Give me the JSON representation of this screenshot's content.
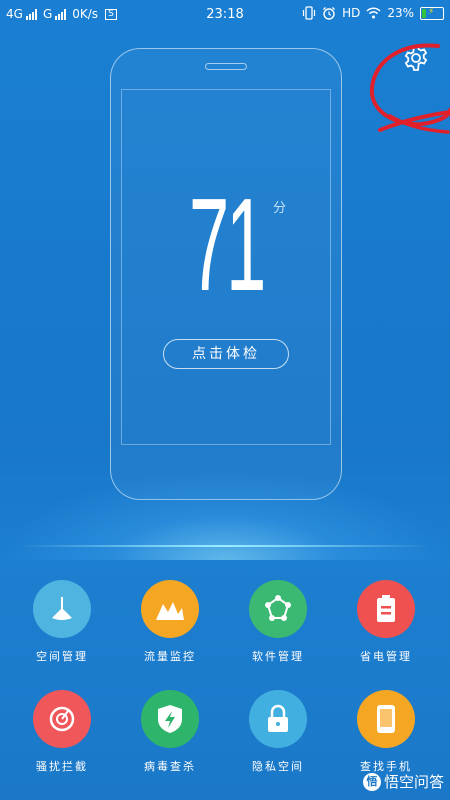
{
  "status_bar": {
    "network_1": "4G",
    "network_2": "G",
    "speed": "0K/s",
    "sim_badge": "S",
    "time": "23:18",
    "hd": "HD",
    "battery_percent": "23%",
    "battery_level": 0.23
  },
  "header": {
    "settings_icon": "gear-icon"
  },
  "phone_card": {
    "score": "71",
    "score_unit": "分",
    "check_button_label": "点击体检"
  },
  "tools": [
    {
      "label": "空间管理",
      "icon": "broom-icon",
      "color": "#4fb4e0"
    },
    {
      "label": "流量监控",
      "icon": "traffic-chart-icon",
      "color": "#f5a623"
    },
    {
      "label": "软件管理",
      "icon": "apps-network-icon",
      "color": "#3bb872"
    },
    {
      "label": "省电管理",
      "icon": "battery-icon",
      "color": "#ef5150"
    },
    {
      "label": "骚扰拦截",
      "icon": "shield-block-icon",
      "color": "#f0575a"
    },
    {
      "label": "病毒查杀",
      "icon": "lightning-shield-icon",
      "color": "#2fb56b"
    },
    {
      "label": "隐私空间",
      "icon": "lock-icon",
      "color": "#41b0e0"
    },
    {
      "label": "查找手机",
      "icon": "phone-icon",
      "color": "#f5a623"
    }
  ],
  "watermark": {
    "text": "悟空问答"
  },
  "colors": {
    "background": "#1877c9",
    "annotation": "#e0202a"
  }
}
